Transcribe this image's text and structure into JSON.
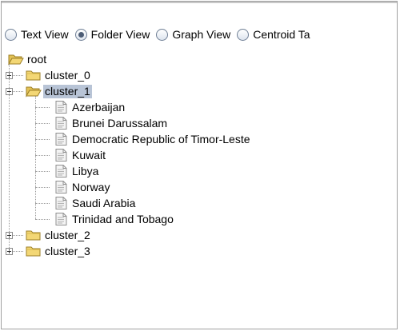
{
  "radio_options": [
    {
      "label": "Text View",
      "checked": false
    },
    {
      "label": "Folder View",
      "checked": true
    },
    {
      "label": "Graph View",
      "checked": false
    },
    {
      "label": "Centroid Ta",
      "checked": false
    }
  ],
  "tree": {
    "root_label": "root",
    "clusters": [
      {
        "label": "cluster_0",
        "expanded": false
      },
      {
        "label": "cluster_1",
        "expanded": true,
        "selected": true,
        "children": [
          "Azerbaijan",
          "Brunei Darussalam",
          "Democratic Republic of Timor-Leste",
          "Kuwait",
          "Libya",
          "Norway",
          "Saudi Arabia",
          "Trinidad and Tobago"
        ]
      },
      {
        "label": "cluster_2",
        "expanded": false
      },
      {
        "label": "cluster_3",
        "expanded": false
      }
    ]
  },
  "colors": {
    "selection": "#b8c4d6",
    "folder": "#f3d775",
    "file": "#f4f4f4"
  }
}
